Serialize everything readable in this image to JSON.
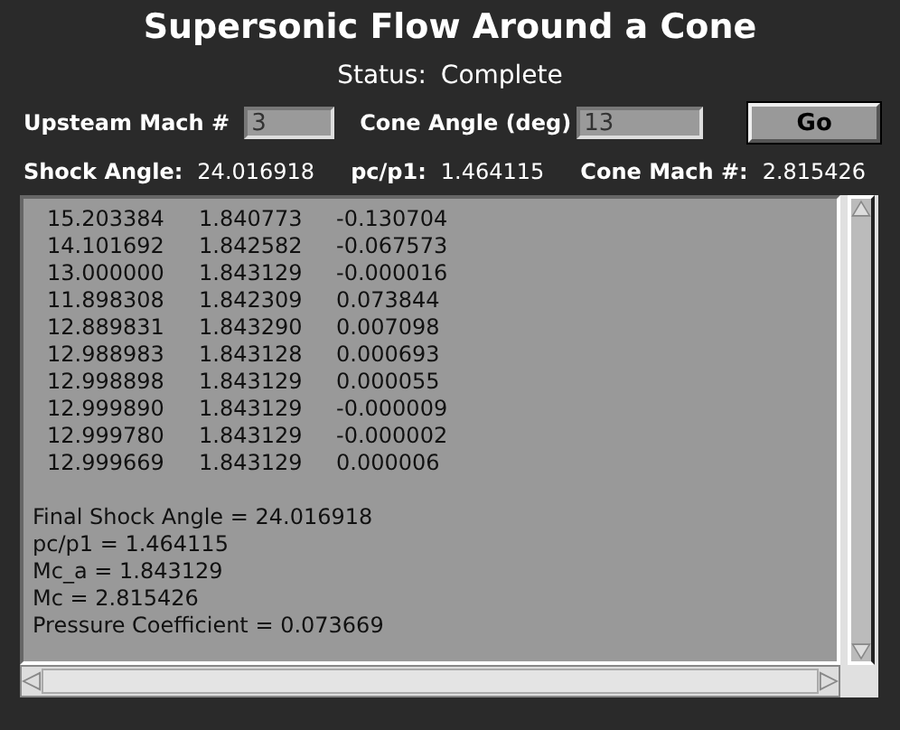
{
  "title": "Supersonic Flow Around a Cone",
  "status": {
    "label": "Status:",
    "value": "Complete"
  },
  "inputs": [
    {
      "label": "Upsteam Mach #",
      "value": "3"
    },
    {
      "label": "Cone Angle (deg)",
      "value": "13"
    }
  ],
  "go_button": "Go",
  "results": [
    {
      "label": "Shock Angle:",
      "value": "24.016918"
    },
    {
      "label": "pc/p1:",
      "value": "1.464115"
    },
    {
      "label": "Cone Mach #:",
      "value": "2.815426"
    }
  ],
  "output": {
    "rows": [
      [
        "15.203384",
        "1.840773",
        "-0.130704"
      ],
      [
        "14.101692",
        "1.842582",
        "-0.067573"
      ],
      [
        "13.000000",
        "1.843129",
        "-0.000016"
      ],
      [
        "11.898308",
        "1.842309",
        "0.073844"
      ],
      [
        "12.889831",
        "1.843290",
        "0.007098"
      ],
      [
        "12.988983",
        "1.843128",
        "0.000693"
      ],
      [
        "12.998898",
        "1.843129",
        "0.000055"
      ],
      [
        "12.999890",
        "1.843129",
        "-0.000009"
      ],
      [
        "12.999780",
        "1.843129",
        "-0.000002"
      ],
      [
        "12.999669",
        "1.843129",
        "0.000006"
      ]
    ],
    "summary": [
      "Final Shock Angle = 24.016918",
      "pc/p1 = 1.464115",
      "Mc_a = 1.843129",
      "Mc = 2.815426",
      "Pressure Coefficient = 0.073669"
    ]
  }
}
